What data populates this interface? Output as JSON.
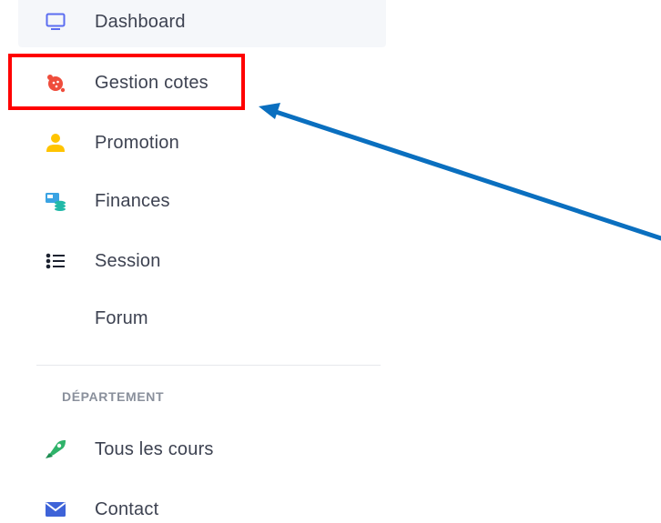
{
  "sidebar": {
    "items": [
      {
        "label": "Dashboard",
        "icon": "monitor-icon"
      },
      {
        "label": "Gestion cotes",
        "icon": "grades-icon"
      },
      {
        "label": "Promotion",
        "icon": "user-icon"
      },
      {
        "label": "Finances",
        "icon": "finance-icon"
      },
      {
        "label": "Session",
        "icon": "list-icon"
      },
      {
        "label": "Forum",
        "icon": ""
      }
    ],
    "section_title": "DÉPARTEMENT",
    "department_items": [
      {
        "label": "Tous les cours",
        "icon": "rocket-icon"
      },
      {
        "label": "Contact",
        "icon": "envelope-icon"
      }
    ]
  },
  "colors": {
    "highlight": "#ff0000",
    "arrow": "#0a6fbf",
    "active_bg": "#f5f7fa"
  }
}
